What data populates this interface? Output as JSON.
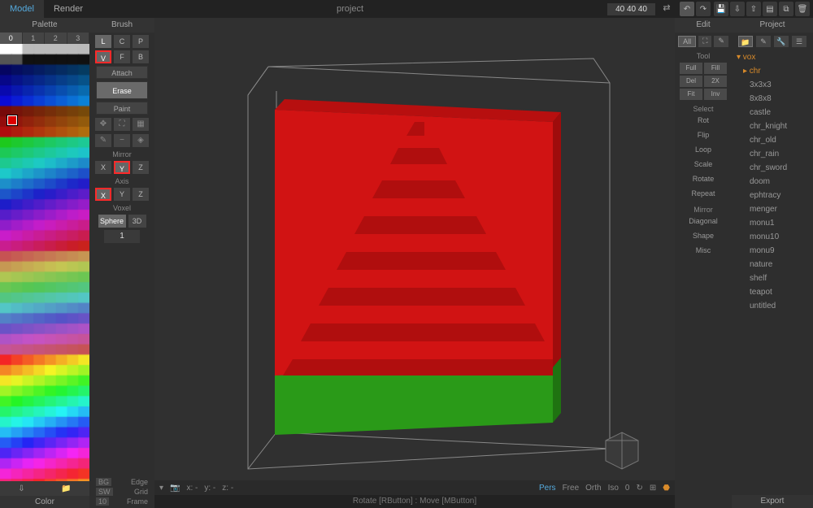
{
  "top": {
    "model": "Model",
    "render": "Render",
    "title": "project",
    "dims": "40  40  40"
  },
  "palette": {
    "head": "Palette",
    "tabs": [
      "0",
      "1",
      "2",
      "3"
    ],
    "footlabel": "Color"
  },
  "brush": {
    "head": "Brush",
    "row1": [
      "L",
      "C",
      "P"
    ],
    "row2": [
      "V",
      "F",
      "B"
    ],
    "attach": "Attach",
    "erase": "Erase",
    "paint": "Paint",
    "mirror": "Mirror",
    "axis": "Axis",
    "voxel": "Voxel",
    "sphere": "Sphere",
    "threeD": "3D",
    "num": "1",
    "bg": "BG",
    "edge": "Edge",
    "sw": "SW",
    "grid": "Grid",
    "ten": "10",
    "frame": "Frame"
  },
  "viewport": {
    "x": "x: -",
    "y": "y: -",
    "z": "z: -",
    "pers": "Pers",
    "free": "Free",
    "orth": "Orth",
    "iso": "Iso",
    "zero": "0",
    "status": "Rotate [RButton] : Move [MButton]"
  },
  "edit": {
    "head": "Edit",
    "all": "All",
    "tool": "Tool",
    "grid": [
      "Full",
      "Fill",
      "Del",
      "2X",
      "Fit",
      "Inv"
    ],
    "select": "Select",
    "ops": [
      "Rot",
      "Flip",
      "Loop",
      "Scale",
      "Rotate",
      "Repeat"
    ],
    "mirror": "Mirror",
    "ops2": [
      "Diagonal",
      "Shape",
      "Misc"
    ]
  },
  "project": {
    "head": "Project",
    "vox": "▾ vox",
    "chr": "▸ chr",
    "files": [
      "3x3x3",
      "8x8x8",
      "castle",
      "chr_knight",
      "chr_old",
      "chr_rain",
      "chr_sword",
      "doom",
      "ephtracy",
      "menger",
      "monu1",
      "monu10",
      "monu9",
      "nature",
      "shelf",
      "teapot",
      "untitled"
    ],
    "export": "Export"
  }
}
